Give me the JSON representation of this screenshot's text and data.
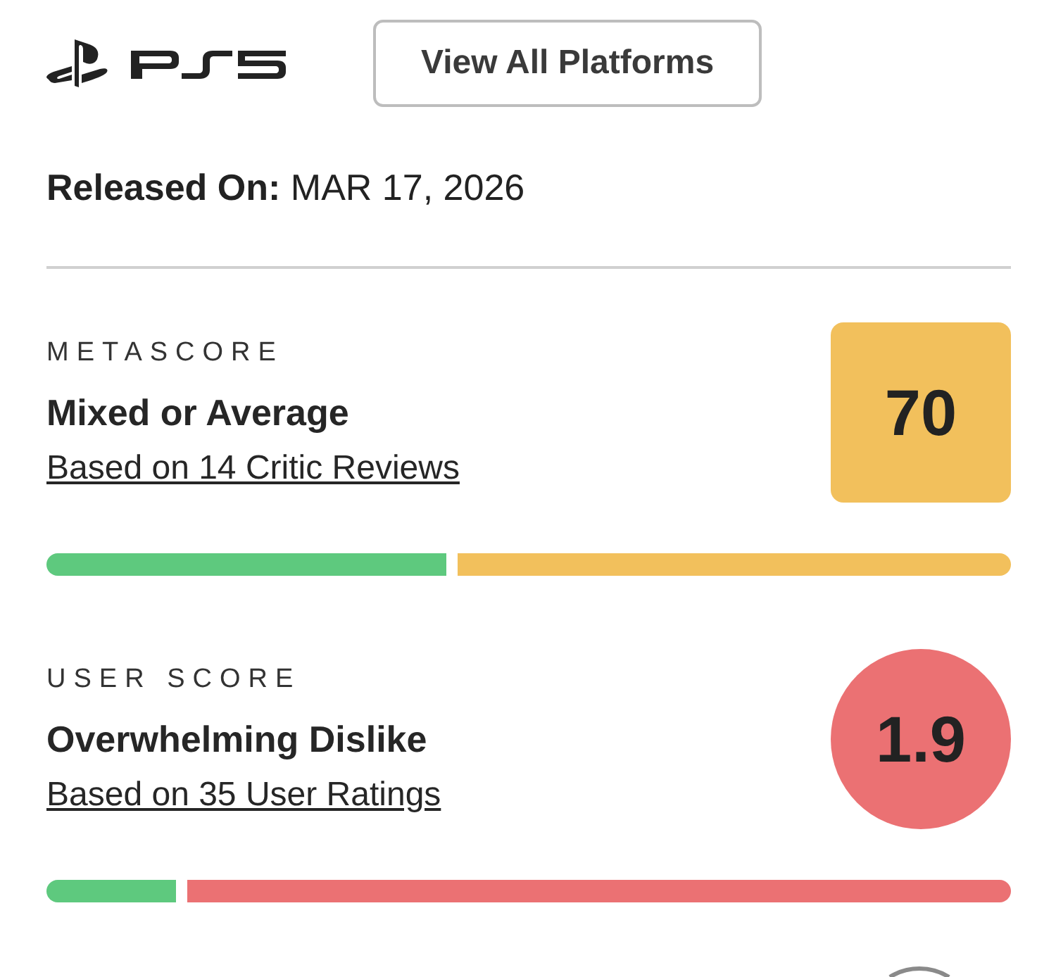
{
  "platform": {
    "button": "View All Platforms"
  },
  "release": {
    "label": "Released On:",
    "date": "MAR 17, 2026"
  },
  "scores": [
    {
      "kind": "critic",
      "label": "METASCORE",
      "verdict": "Mixed or Average",
      "link": "Based on 14 Critic Reviews",
      "score": "70",
      "color": "#f2c05c",
      "level": 0.42
    },
    {
      "kind": "user",
      "label": "USER SCORE",
      "verdict": "Overwhelming Dislike",
      "link": "Based on 35 User Ratings",
      "score": "1.9",
      "color": "#eb7173",
      "level": 0.14
    }
  ]
}
